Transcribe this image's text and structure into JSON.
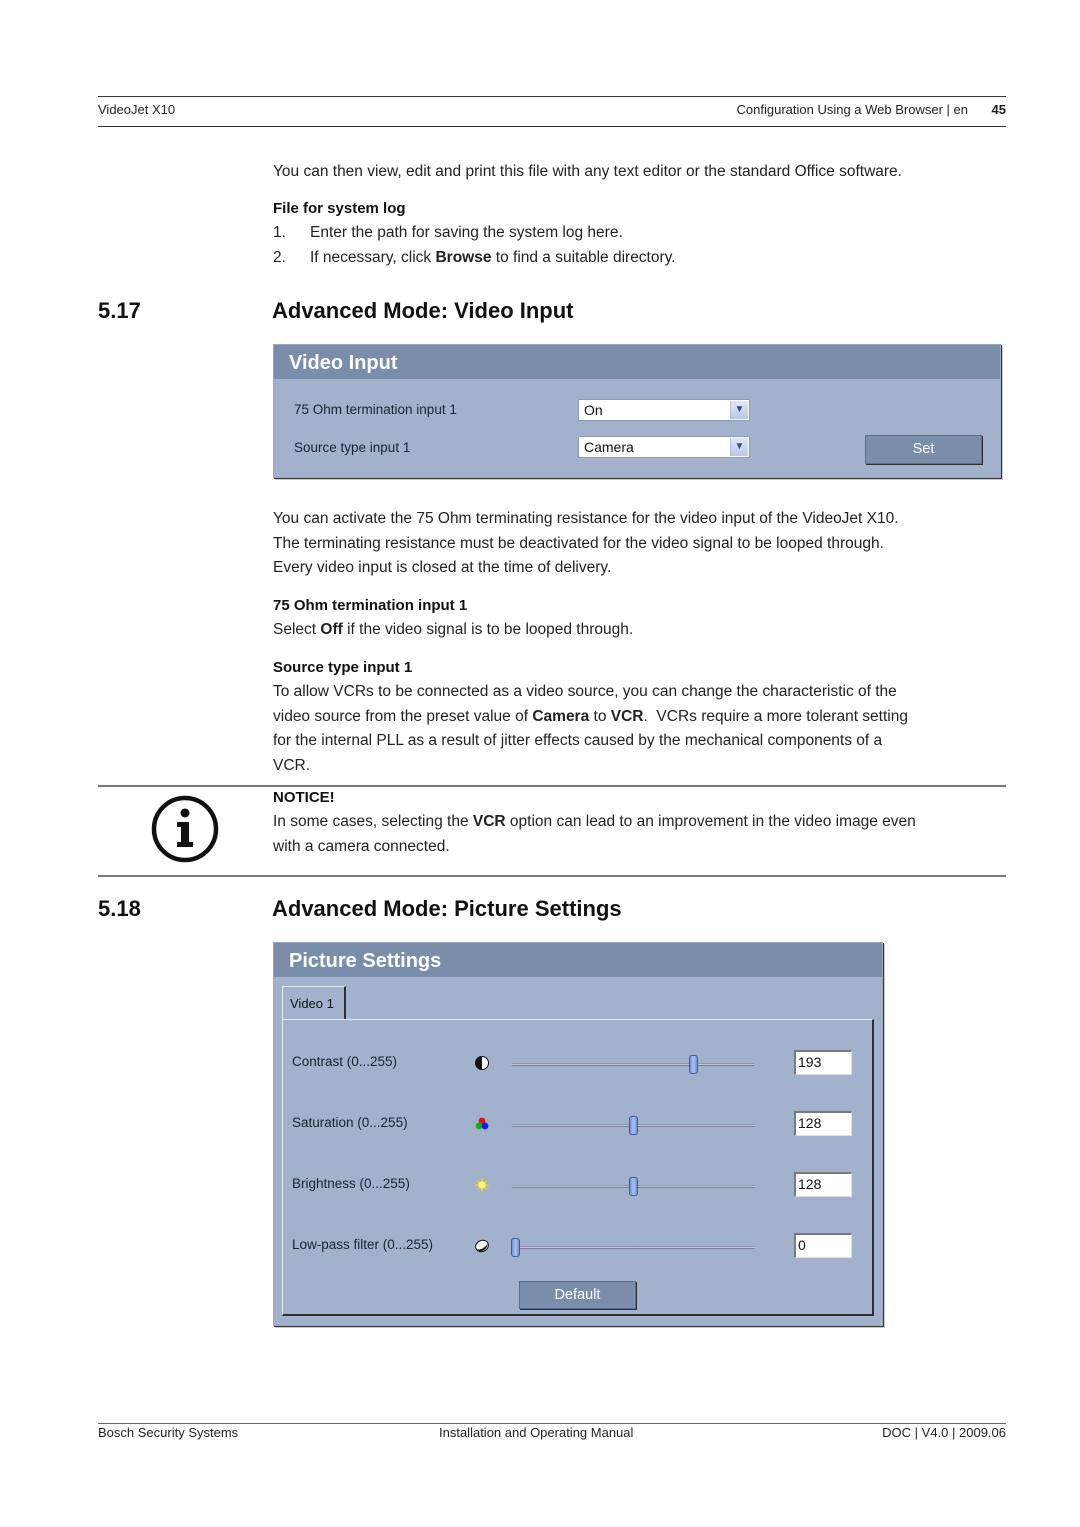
{
  "header": {
    "product": "VideoJet X10",
    "section": "Configuration Using a Web Browser | en",
    "page_number": "45"
  },
  "intro": {
    "paragraph": "You can then view, edit and print this file with any text editor or the standard Office software.",
    "file_log_heading": "File for system log",
    "steps": [
      {
        "num": "1.",
        "text": "Enter the path for saving the system log here."
      },
      {
        "num": "2.",
        "pre": "If necessary, click ",
        "bold": "Browse",
        "post": " to find a suitable directory."
      }
    ]
  },
  "section_517": {
    "number": "5.17",
    "title": "Advanced Mode: Video Input",
    "panel": {
      "title": "Video Input",
      "fields": [
        {
          "label": "75 Ohm termination input 1",
          "value": "On"
        },
        {
          "label": "Source type input 1",
          "value": "Camera"
        }
      ],
      "set_button": "Set"
    },
    "para1": "You can activate the 75 Ohm terminating resistance for the video input of the VideoJet X10. The terminating resistance must be deactivated for the video signal to be looped through. Every video input is closed at the time of delivery.",
    "para1_lines": [
      "You can activate the 75 Ohm terminating resistance for the video input of the VideoJet X10.",
      "The terminating resistance must be deactivated for the video signal to be looped through.",
      "Every video input is closed at the time of delivery."
    ],
    "termination_heading": "75 Ohm termination input 1",
    "termination_text": {
      "pre": "Select ",
      "bold": "Off",
      "post": " if the video signal is to be looped through."
    },
    "source_heading": "Source type input 1",
    "source_text": {
      "l1": "To allow VCRs to be connected as a video source, you can change the characteristic of the",
      "l2_pre": "video source from the preset value of ",
      "l2_b1": "Camera",
      "l2_mid": " to ",
      "l2_b2": "VCR",
      "l2_post": ".  VCRs require a more tolerant setting",
      "l3": "for the internal PLL as a result of jitter effects caused by the mechanical components of a",
      "l4": "VCR."
    },
    "notice": {
      "heading": "NOTICE!",
      "l1_pre": "In some cases, selecting the ",
      "l1_bold": "VCR",
      "l1_post": " option can lead to an improvement in the video image even",
      "l2": "with a camera connected.",
      "icon": "info-icon"
    }
  },
  "section_518": {
    "number": "5.18",
    "title": "Advanced Mode: Picture Settings",
    "panel": {
      "title": "Picture Settings",
      "tab": "Video 1",
      "sliders": [
        {
          "label": "Contrast (0...255)",
          "icon": "contrast-icon",
          "value": "193",
          "min": 0,
          "max": 255,
          "position": 193
        },
        {
          "label": "Saturation (0...255)",
          "icon": "saturation-icon",
          "value": "128",
          "min": 0,
          "max": 255,
          "position": 128
        },
        {
          "label": "Brightness (0...255)",
          "icon": "brightness-icon",
          "value": "128",
          "min": 0,
          "max": 255,
          "position": 128
        },
        {
          "label": "Low-pass filter (0...255)",
          "icon": "lowpass-filter-icon",
          "value": "0",
          "min": 0,
          "max": 255,
          "position": 0
        }
      ],
      "default_button": "Default"
    }
  },
  "footer": {
    "company": "Bosch Security Systems",
    "manual": "Installation and Operating Manual",
    "doc": "DOC | V4.0 | 2009.06"
  }
}
